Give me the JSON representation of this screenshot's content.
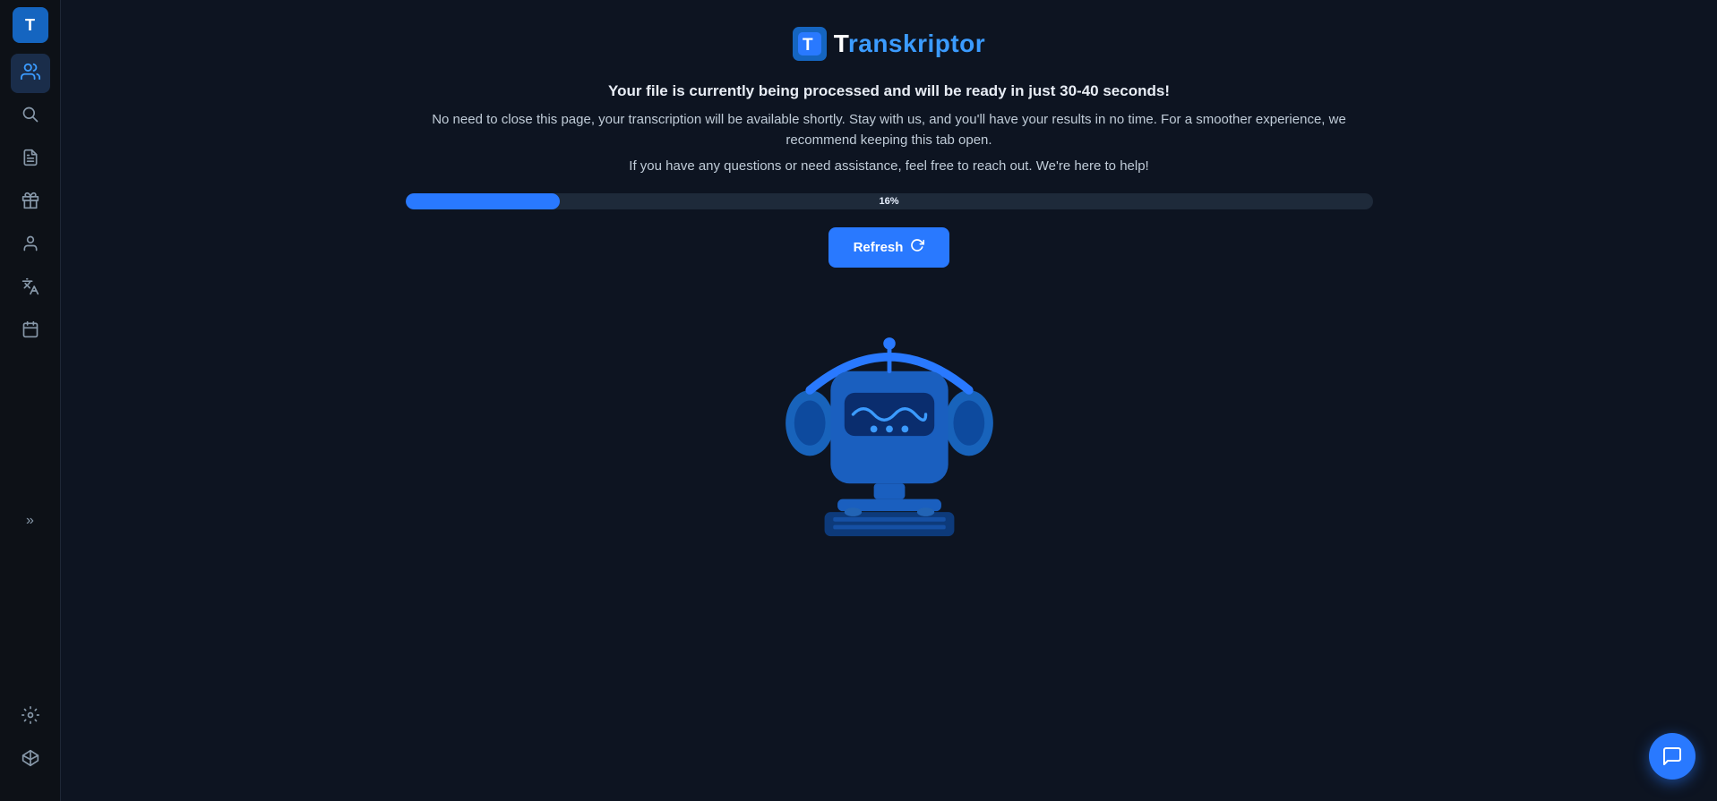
{
  "logo": {
    "icon_letter": "T",
    "brand_name_prefix": "T",
    "brand_name_rest": "ranskriptor"
  },
  "sidebar": {
    "items": [
      {
        "name": "users-icon",
        "unicode": "👥",
        "active": true
      },
      {
        "name": "search-icon",
        "unicode": "🔍",
        "active": false
      },
      {
        "name": "file-icon",
        "unicode": "📄",
        "active": false
      },
      {
        "name": "gift-icon",
        "unicode": "🎁",
        "active": false
      },
      {
        "name": "person-icon",
        "unicode": "👤",
        "active": false
      },
      {
        "name": "translate-icon",
        "unicode": "🈳",
        "active": false
      },
      {
        "name": "calendar-icon",
        "unicode": "📅",
        "active": false
      },
      {
        "name": "tools-icon",
        "unicode": "🔧",
        "active": false
      },
      {
        "name": "diamond-icon",
        "unicode": "💎",
        "active": false
      }
    ],
    "expand_label": "»"
  },
  "processing": {
    "line1": "Your file is currently being processed and will be ready in just 30-40 seconds!",
    "line2": "No need to close this page, your transcription will be available shortly. Stay with us, and you'll have your results in no time. For a smoother experience, we recommend keeping this tab open.",
    "line3": "If you have any questions or need assistance, feel free to reach out. We're here to help!",
    "progress_percent": 16,
    "progress_label": "16%",
    "refresh_button": "Refresh"
  },
  "colors": {
    "blue_accent": "#2979ff",
    "progress_fill": "#2979ff",
    "progress_bg": "#1e2a3a",
    "bg_main": "#0d1421",
    "bg_sidebar": "#0d1117"
  }
}
